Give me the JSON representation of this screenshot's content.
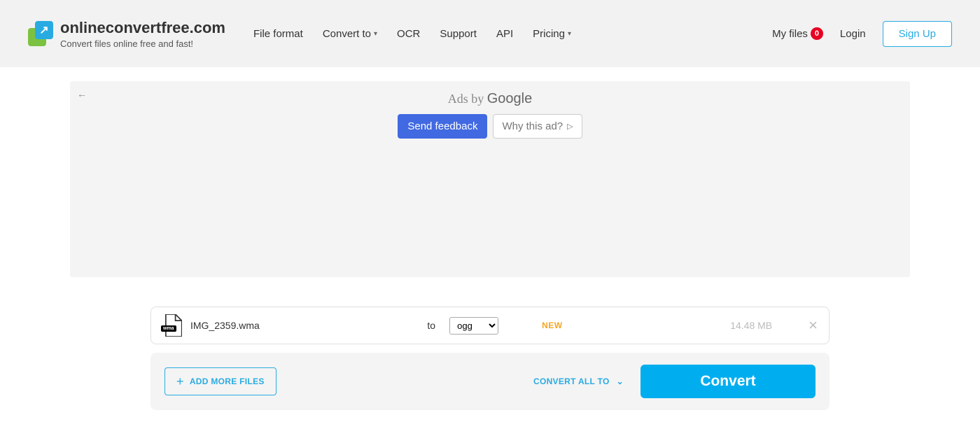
{
  "header": {
    "site_name": "onlineconvertfree.com",
    "tagline": "Convert files online free and fast!",
    "nav": {
      "file_format": "File format",
      "convert_to": "Convert to",
      "ocr": "OCR",
      "support": "Support",
      "api": "API",
      "pricing": "Pricing"
    },
    "my_files_label": "My files",
    "my_files_count": "0",
    "login": "Login",
    "signup": "Sign Up"
  },
  "ad": {
    "title_prefix": "Ads by ",
    "title_brand": "Google",
    "feedback": "Send feedback",
    "why": "Why this ad?"
  },
  "file": {
    "ext_badge": "wma",
    "name": "IMG_2359.wma",
    "to_label": "to",
    "selected_format": "ogg",
    "formats": [
      "ogg"
    ],
    "new_badge": "NEW",
    "size": "14.48 MB"
  },
  "actions": {
    "add_more": "ADD MORE FILES",
    "convert_all": "CONVERT ALL TO",
    "convert": "Convert"
  }
}
